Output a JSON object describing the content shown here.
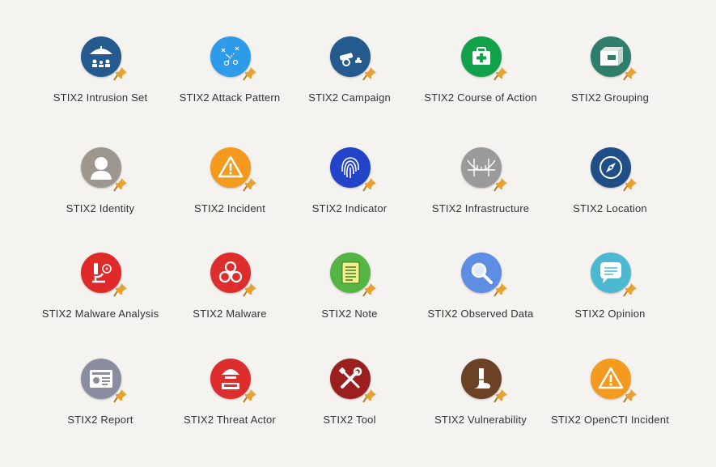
{
  "items": [
    {
      "label": "STIX2 Intrusion Set",
      "icon": "intrusion-set-icon",
      "color": "#245a8d"
    },
    {
      "label": "STIX2 Attack Pattern",
      "icon": "attack-pattern-icon",
      "color": "#2b9bea"
    },
    {
      "label": "STIX2 Campaign",
      "icon": "campaign-icon",
      "color": "#245a8d"
    },
    {
      "label": "STIX2 Course of Action",
      "icon": "course-of-action-icon",
      "color": "#12a14b"
    },
    {
      "label": "STIX2 Grouping",
      "icon": "grouping-icon",
      "color": "#2f7d6b"
    },
    {
      "label": "STIX2 Identity",
      "icon": "identity-icon",
      "color": "#9e9790"
    },
    {
      "label": "STIX2 Incident",
      "icon": "incident-icon",
      "color": "#f39a1f"
    },
    {
      "label": "STIX2 Indicator",
      "icon": "indicator-icon",
      "color": "#2343c9"
    },
    {
      "label": "STIX2 Infrastructure",
      "icon": "infrastructure-icon",
      "color": "#9a9a9a"
    },
    {
      "label": "STIX2 Location",
      "icon": "location-icon",
      "color": "#1f4f86"
    },
    {
      "label": "STIX2 Malware Analysis",
      "icon": "malware-analysis-icon",
      "color": "#e02a2a"
    },
    {
      "label": "STIX2 Malware",
      "icon": "malware-icon",
      "color": "#dd2d2d"
    },
    {
      "label": "STIX2 Note",
      "icon": "note-icon",
      "color": "#55b544"
    },
    {
      "label": "STIX2 Observed Data",
      "icon": "observed-data-icon",
      "color": "#5e8ee4"
    },
    {
      "label": "STIX2 Opinion",
      "icon": "opinion-icon",
      "color": "#4cb8d1"
    },
    {
      "label": "STIX2 Report",
      "icon": "report-icon",
      "color": "#8a8ca0"
    },
    {
      "label": "STIX2 Threat Actor",
      "icon": "threat-actor-icon",
      "color": "#dd2d2d"
    },
    {
      "label": "STIX2 Tool",
      "icon": "tool-icon",
      "color": "#9b1f1f"
    },
    {
      "label": "STIX2 Vulnerability",
      "icon": "vulnerability-icon",
      "color": "#6b4226"
    },
    {
      "label": "STIX2 OpenCTI Incident",
      "icon": "incident-icon",
      "color": "#f39a1f"
    }
  ],
  "pin_icon": "pin-icon",
  "pin_color": "#e6a234"
}
